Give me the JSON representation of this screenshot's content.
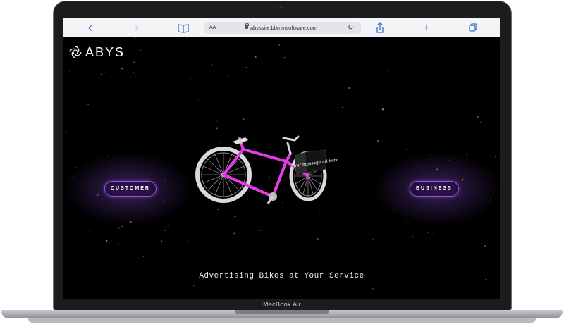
{
  "browser": {
    "aa_label": "AA",
    "url": "abyssite.bbmmsoftware.com",
    "back_glyph": "‹",
    "forward_glyph": "›",
    "bookmarks_icon": "book-icon",
    "reload_glyph": "↻",
    "share_icon": "share-icon",
    "new_tab_glyph": "+",
    "tabs_icon": "tabs-icon",
    "accent_color": "#2f6ed8"
  },
  "site": {
    "logo_text": "ABYS",
    "customer_button": "CUSTOMER",
    "business_button": "BUSINESS",
    "bike_sign_text": "Your message ad here",
    "tagline": "Advertising Bikes at Your Service",
    "bike_color": "#e43ae6",
    "button_glow_color": "#8b5ad9"
  },
  "device": {
    "model_label": "MacBook Air"
  }
}
